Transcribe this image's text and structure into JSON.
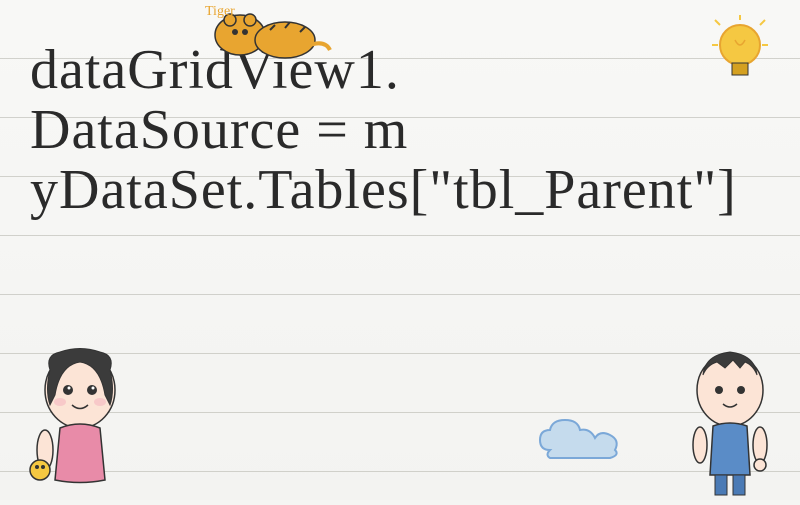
{
  "code": {
    "line1": "dataGridView1.",
    "line2": "DataSource = m",
    "line3": "yDataSet.Tables[\"tbl_Parent\"]"
  },
  "doodles": {
    "tiger": "tiger-doodle",
    "lightbulb": "lightbulb-doodle",
    "cloud": "cloud-doodle",
    "girl": "girl-cartoon",
    "boy": "boy-cartoon"
  },
  "colors": {
    "tiger_orange": "#e8a530",
    "lightbulb_yellow": "#f5c842",
    "cloud_blue": "#7ba8d8",
    "girl_hair": "#3b3b3b",
    "boy_blue": "#5a8cc7"
  }
}
